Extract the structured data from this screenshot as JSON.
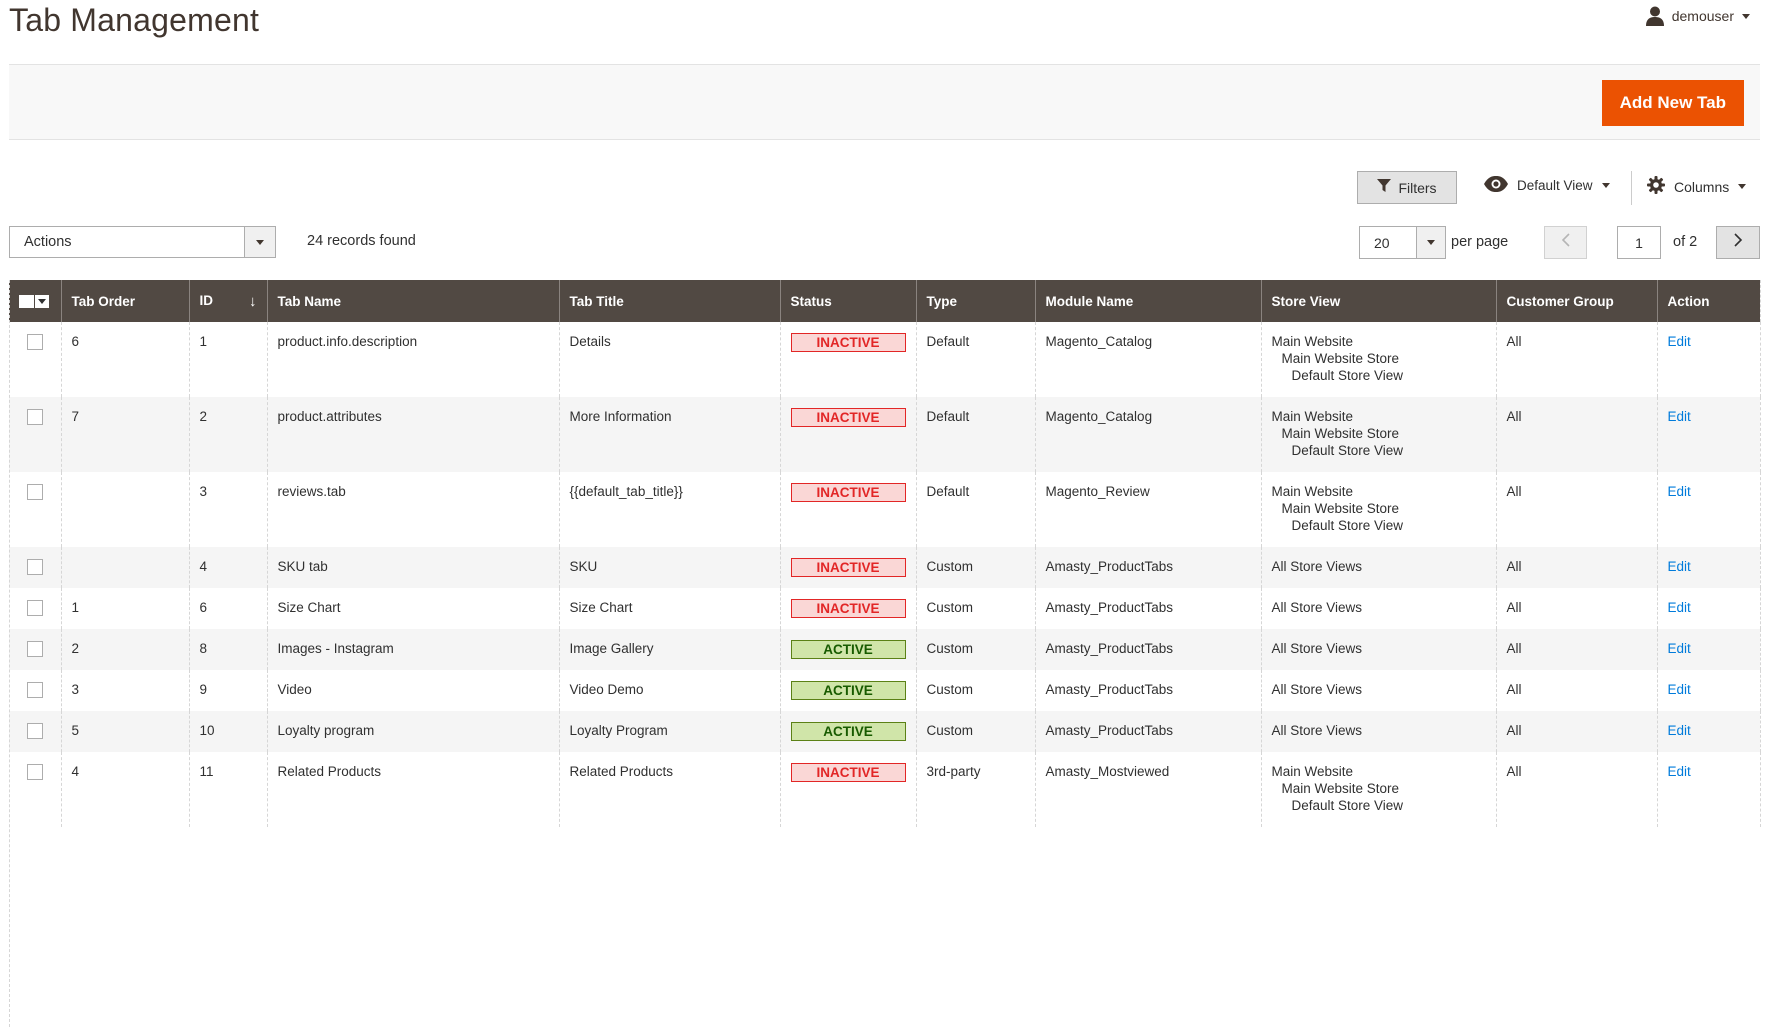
{
  "header": {
    "title": "Tab Management",
    "user": "demouser"
  },
  "action_bar": {
    "add_button": "Add New Tab"
  },
  "toolbar": {
    "filters_label": "Filters",
    "view_label": "Default View",
    "columns_label": "Columns",
    "actions_label": "Actions",
    "records_found": "24 records found",
    "per_page_value": "20",
    "per_page_label": "per page",
    "current_page": "1",
    "of_pages": "of 2"
  },
  "colors": {
    "accent": "#eb5202",
    "header_bg": "#514943",
    "inactive": "#e22626",
    "active": "#5b8116",
    "link": "#007bdb"
  },
  "grid": {
    "columns": [
      "Tab Order",
      "ID",
      "Tab Name",
      "Tab Title",
      "Status",
      "Type",
      "Module Name",
      "Store View",
      "Customer Group",
      "Action"
    ],
    "rows": [
      {
        "tab_order": "6",
        "id": "1",
        "tab_name": "product.info.description",
        "tab_title": "Details",
        "status": "INACTIVE",
        "type": "Default",
        "module": "Magento_Catalog",
        "store_view": [
          "Main Website",
          "Main Website Store",
          "Default Store View"
        ],
        "customer_group": "All",
        "action": "Edit"
      },
      {
        "tab_order": "7",
        "id": "2",
        "tab_name": "product.attributes",
        "tab_title": "More Information",
        "status": "INACTIVE",
        "type": "Default",
        "module": "Magento_Catalog",
        "store_view": [
          "Main Website",
          "Main Website Store",
          "Default Store View"
        ],
        "customer_group": "All",
        "action": "Edit"
      },
      {
        "tab_order": "",
        "id": "3",
        "tab_name": "reviews.tab",
        "tab_title": "{{default_tab_title}}",
        "status": "INACTIVE",
        "type": "Default",
        "module": "Magento_Review",
        "store_view": [
          "Main Website",
          "Main Website Store",
          "Default Store View"
        ],
        "customer_group": "All",
        "action": "Edit"
      },
      {
        "tab_order": "",
        "id": "4",
        "tab_name": "SKU tab",
        "tab_title": "SKU",
        "status": "INACTIVE",
        "type": "Custom",
        "module": "Amasty_ProductTabs",
        "store_view": [
          "All Store Views"
        ],
        "customer_group": "All",
        "action": "Edit"
      },
      {
        "tab_order": "1",
        "id": "6",
        "tab_name": "Size Chart",
        "tab_title": "Size Chart",
        "status": "INACTIVE",
        "type": "Custom",
        "module": "Amasty_ProductTabs",
        "store_view": [
          "All Store Views"
        ],
        "customer_group": "All",
        "action": "Edit"
      },
      {
        "tab_order": "2",
        "id": "8",
        "tab_name": "Images - Instagram",
        "tab_title": "Image Gallery",
        "status": "ACTIVE",
        "type": "Custom",
        "module": "Amasty_ProductTabs",
        "store_view": [
          "All Store Views"
        ],
        "customer_group": "All",
        "action": "Edit"
      },
      {
        "tab_order": "3",
        "id": "9",
        "tab_name": "Video",
        "tab_title": "Video Demo",
        "status": "ACTIVE",
        "type": "Custom",
        "module": "Amasty_ProductTabs",
        "store_view": [
          "All Store Views"
        ],
        "customer_group": "All",
        "action": "Edit"
      },
      {
        "tab_order": "5",
        "id": "10",
        "tab_name": "Loyalty program",
        "tab_title": "Loyalty Program",
        "status": "ACTIVE",
        "type": "Custom",
        "module": "Amasty_ProductTabs",
        "store_view": [
          "All Store Views"
        ],
        "customer_group": "All",
        "action": "Edit"
      },
      {
        "tab_order": "4",
        "id": "11",
        "tab_name": "Related Products",
        "tab_title": "Related Products",
        "status": "INACTIVE",
        "type": "3rd-party",
        "module": "Amasty_Mostviewed",
        "store_view": [
          "Main Website",
          "Main Website Store",
          "Default Store View"
        ],
        "customer_group": "All",
        "action": "Edit"
      }
    ]
  }
}
